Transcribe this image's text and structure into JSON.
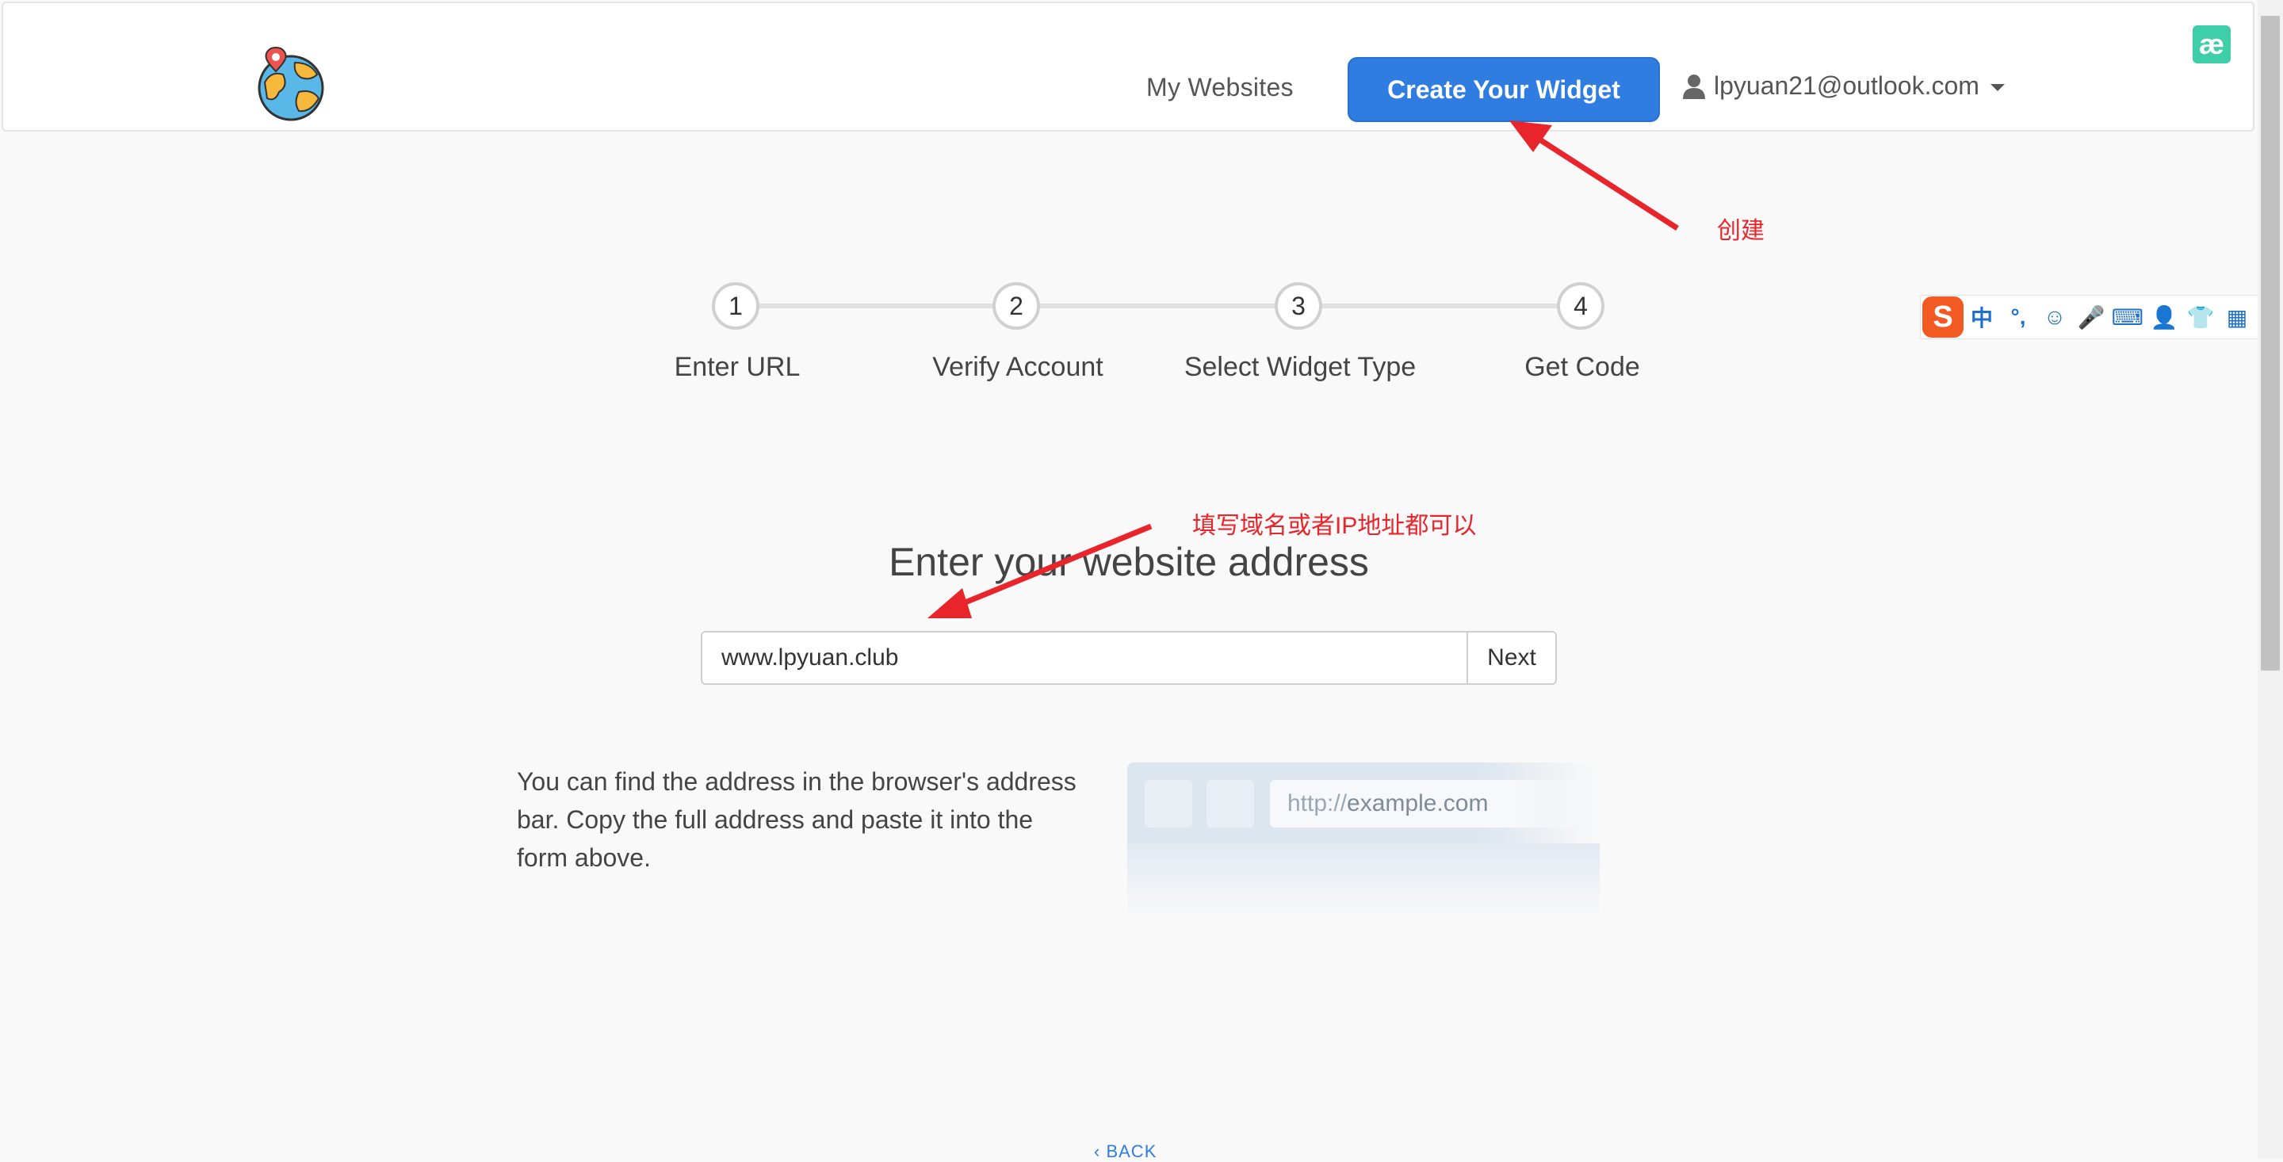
{
  "header": {
    "nav_my_websites": "My Websites",
    "create_widget_label": "Create Your Widget",
    "user_email": "lpyuan21@outlook.com",
    "extension_badge": "æ"
  },
  "steps": [
    {
      "number": "1",
      "label": "Enter URL"
    },
    {
      "number": "2",
      "label": "Verify Account"
    },
    {
      "number": "3",
      "label": "Select Widget Type"
    },
    {
      "number": "4",
      "label": "Get Code"
    }
  ],
  "form": {
    "title": "Enter your website address",
    "url_value": "www.lpyuan.club",
    "next_label": "Next"
  },
  "help": {
    "text": "You can find the address in the browser's address bar. Copy the full address and paste it into the form above.",
    "illus_protocol": "http://",
    "illus_host": "example.com"
  },
  "footer": {
    "back_label": "BACK"
  },
  "ime": {
    "logo": "S",
    "items": [
      "中",
      "°,",
      "☺",
      "🎤",
      "⌨",
      "👤",
      "👕",
      "▦"
    ]
  },
  "annotations": {
    "create_note": "创建",
    "url_note": "填写域名或者IP地址都可以"
  },
  "colors": {
    "primary": "#2f7de1",
    "annotation": "#e8252b",
    "background": "#f9f9f9"
  }
}
